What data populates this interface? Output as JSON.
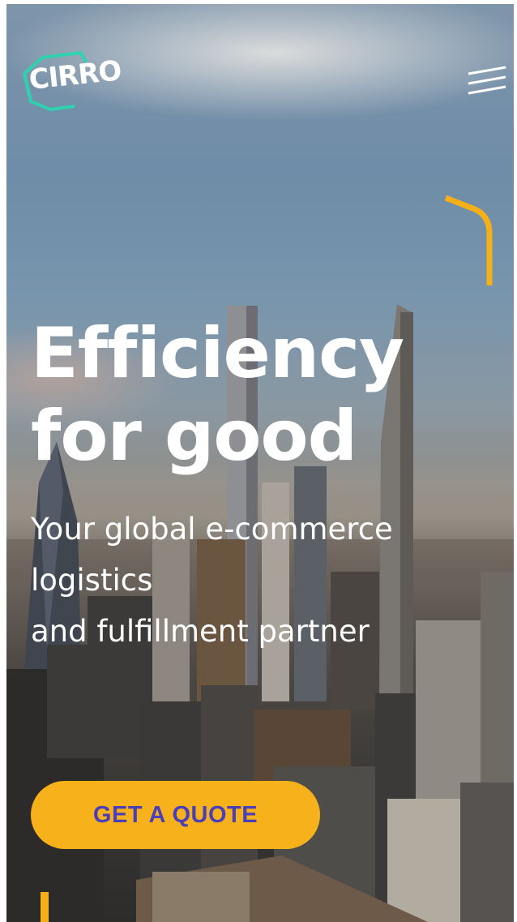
{
  "header": {
    "logo_text": "CIRRO",
    "menu_icon": "hamburger-menu-icon"
  },
  "hero": {
    "title_line1": "Efficiency",
    "title_line2": "for good",
    "subtitle_line1": "Your global e-commerce",
    "subtitle_line2": "logistics",
    "subtitle_line3": "and fulfillment partner",
    "cta_label": "GET A QUOTE"
  },
  "colors": {
    "accent": "#f7b21b",
    "cta_text": "#4b3fb8",
    "logo_outline": "#2fd2b0",
    "text": "#ffffff"
  }
}
